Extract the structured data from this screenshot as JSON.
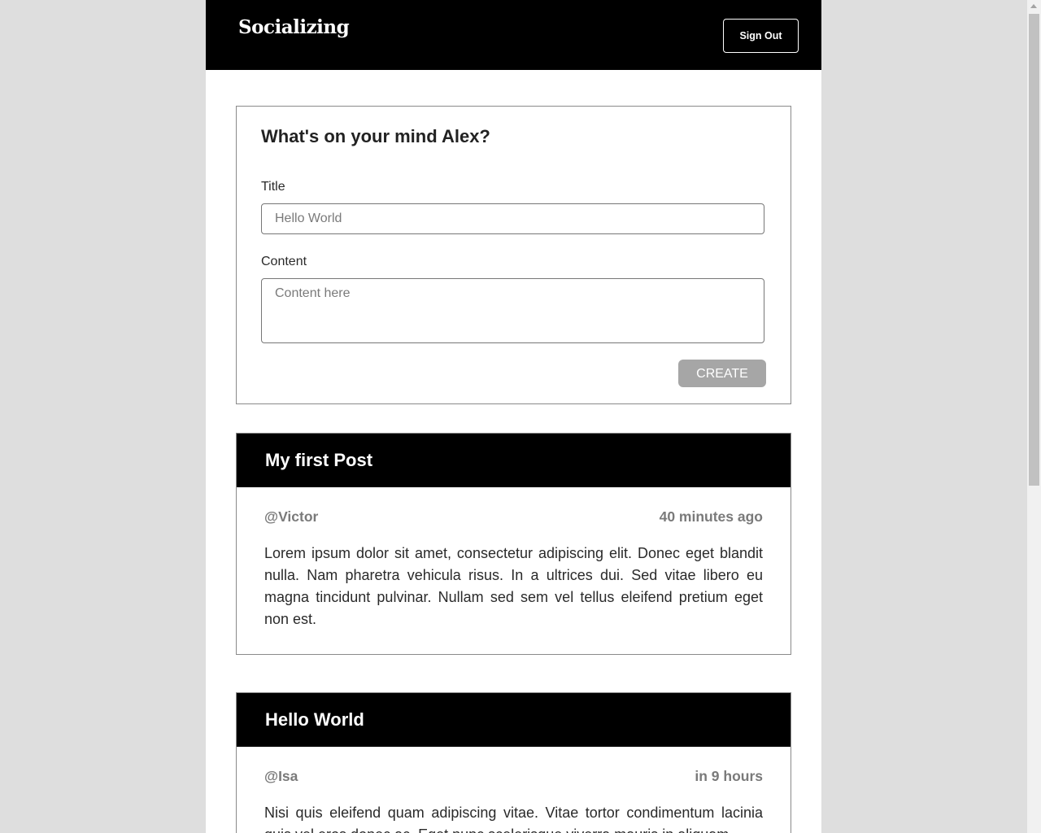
{
  "header": {
    "brand": "Socializing",
    "sign_out_label": "Sign Out"
  },
  "composer": {
    "heading": "What's on your mind Alex?",
    "title_label": "Title",
    "title_placeholder": "Hello World",
    "content_label": "Content",
    "content_placeholder": "Content here",
    "create_label": "CREATE"
  },
  "posts": [
    {
      "title": "My first Post",
      "author": "@Victor",
      "time": "40 minutes ago",
      "body": "Lorem ipsum dolor sit amet, consectetur adipiscing elit. Donec eget blandit nulla. Nam pharetra vehicula risus. In a ultrices dui. Sed vitae libero eu magna tincidunt pulvinar. Nullam sed sem vel tellus eleifend pretium eget non est."
    },
    {
      "title": "Hello World",
      "author": "@Isa",
      "time": "in 9 hours",
      "body": "Nisi quis eleifend quam adipiscing vitae. Vitae tortor condimentum lacinia quis vel eros donec ac. Eget nunc scelerisque viverra mauris in aliquam."
    }
  ]
}
